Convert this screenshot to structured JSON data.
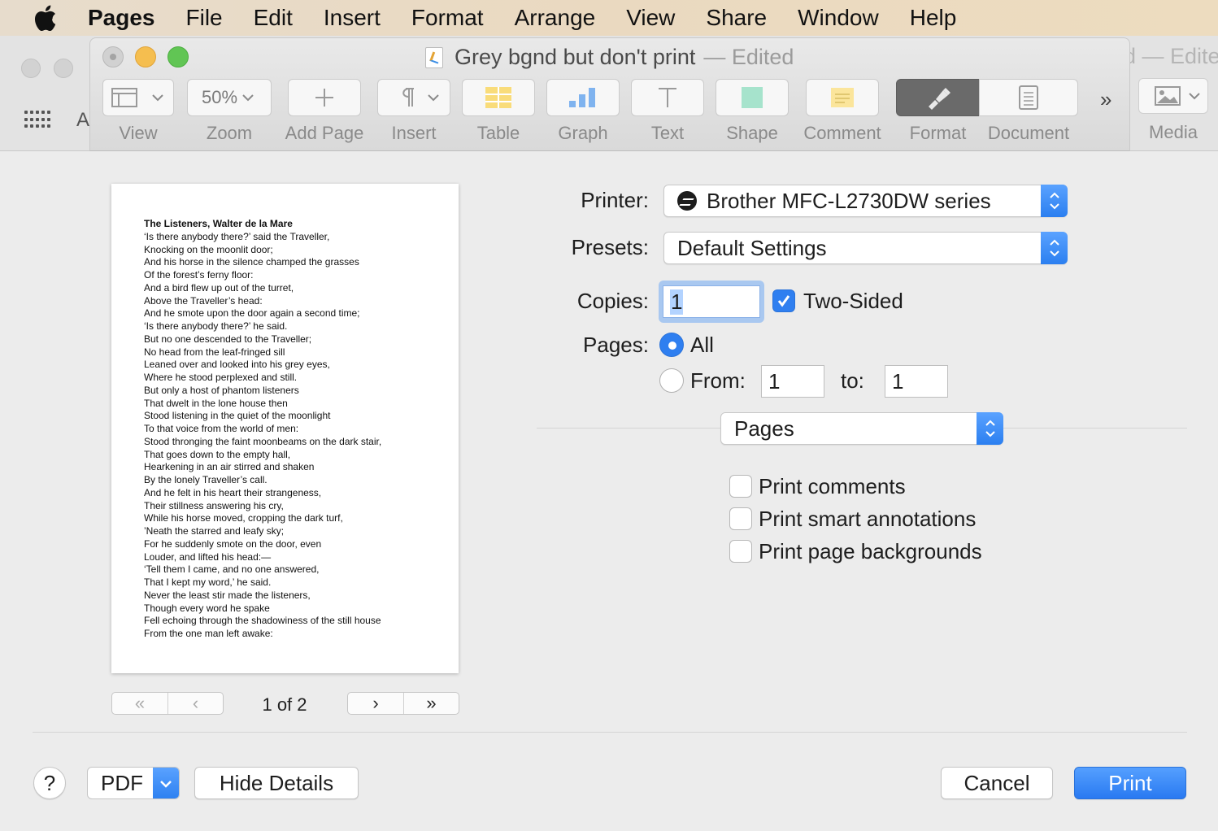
{
  "menubar": {
    "app_name": "Pages",
    "items": [
      "File",
      "Edit",
      "Insert",
      "Format",
      "Arrange",
      "View",
      "Share",
      "Window",
      "Help"
    ]
  },
  "back_window": {
    "title_fragment": "d — Edite",
    "letter": "A",
    "media_label": "Media"
  },
  "window": {
    "title": "Grey bgnd but don't print",
    "edited": "— Edited"
  },
  "toolbar": {
    "view_label": "View",
    "zoom_value": "50%",
    "zoom_label": "Zoom",
    "add_page_label": "Add Page",
    "insert_label": "Insert",
    "table_label": "Table",
    "graph_label": "Graph",
    "text_label": "Text",
    "shape_label": "Shape",
    "comment_label": "Comment",
    "format_label": "Format",
    "document_label": "Document",
    "more_glyph": "»"
  },
  "preview": {
    "title": "The Listeners, Walter de la Mare",
    "lines": [
      "‘Is there anybody there?’ said the Traveller,",
      "Knocking on the moonlit door;",
      "And his horse in the silence champed the grasses",
      "Of the forest’s ferny floor:",
      "And a bird flew up out of the turret,",
      "Above the Traveller’s head:",
      "And he smote upon the door again a second time;",
      "‘Is there anybody there?’ he said.",
      "But no one descended to the Traveller;",
      "No head from the leaf-fringed sill",
      "Leaned over and looked into his grey eyes,",
      "Where he stood perplexed and still.",
      "But only a host of phantom listeners",
      "That dwelt in the lone house then",
      "Stood listening in the quiet of the moonlight",
      "To that voice from the world of men:",
      "Stood thronging the faint moonbeams on the dark stair,",
      "That goes down to the empty hall,",
      "Hearkening in an air stirred and shaken",
      "By the lonely Traveller’s call.",
      "And he felt in his heart their strangeness,",
      "Their stillness answering his cry,",
      "While his horse moved, cropping the dark turf,",
      "’Neath the starred and leafy sky;",
      "For he suddenly smote on the door, even",
      "Louder, and lifted his head:—",
      "‘Tell them I came, and no one answered,",
      "That I kept my word,’ he said.",
      "Never the least stir made the listeners,",
      "Though every word he spake",
      "Fell echoing through the shadowiness of the still house",
      "From the one man left awake:"
    ],
    "nav_first": "«",
    "nav_prev": "‹",
    "nav_next": "›",
    "nav_last": "»",
    "page_counter": "1 of 2"
  },
  "print": {
    "printer_label": "Printer:",
    "printer_value": "Brother MFC-L2730DW series",
    "presets_label": "Presets:",
    "presets_value": "Default Settings",
    "copies_label": "Copies:",
    "copies_value": "1",
    "two_sided_label": "Two-Sided",
    "two_sided_checked": true,
    "pages_label": "Pages:",
    "pages_all_label": "All",
    "pages_from_label": "From:",
    "pages_from_value": "1",
    "pages_to_label": "to:",
    "pages_to_value": "1",
    "section_value": "Pages",
    "options": [
      {
        "label": "Print comments",
        "checked": false
      },
      {
        "label": "Print smart annotations",
        "checked": false
      },
      {
        "label": "Print page backgrounds",
        "checked": false
      }
    ]
  },
  "footer": {
    "help_label": "?",
    "pdf_label": "PDF",
    "hide_details_label": "Hide Details",
    "cancel_label": "Cancel",
    "print_label": "Print"
  },
  "colors": {
    "accent": "#2f7ff0",
    "menubar_bg": "#ead9c0",
    "dialog_bg": "#ececec"
  }
}
